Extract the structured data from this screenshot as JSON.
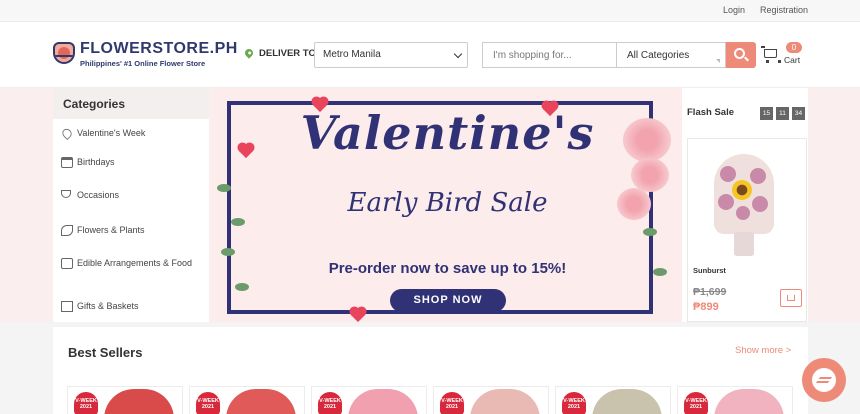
{
  "topbar": {
    "login": "Login",
    "register": "Registration"
  },
  "header": {
    "brand": "FLOWERSTORE.PH",
    "tagline": "Philippines' #1 Online Flower Store",
    "deliver_label": "DELIVER TO",
    "location": "Metro Manila",
    "search_placeholder": "I'm shopping for...",
    "category_select": "All Categories",
    "cart_count": "0",
    "cart_label": "Cart"
  },
  "sidebar": {
    "title": "Categories",
    "items": [
      {
        "label": "Valentine's Week",
        "icon": "heart-icon"
      },
      {
        "label": "Birthdays",
        "icon": "cake-icon"
      },
      {
        "label": "Occasions",
        "icon": "wine-glass-icon"
      },
      {
        "label": "Flowers & Plants",
        "icon": "plant-icon"
      },
      {
        "label": "Edible Arrangements & Food",
        "icon": "basket-icon"
      },
      {
        "label": "Gifts & Baskets",
        "icon": "gift-icon"
      }
    ]
  },
  "banner": {
    "line1": "Valentine's",
    "line2": "Early Bird Sale",
    "promo": "Pre-order now to save up to 15%!",
    "cta": "SHOP NOW"
  },
  "flash_sale": {
    "title": "Flash Sale",
    "timer": [
      "15",
      "11",
      "34"
    ],
    "product": {
      "name": "Sunburst",
      "old_price": "₱1,699",
      "new_price": "₱899"
    }
  },
  "best_sellers": {
    "title": "Best Sellers",
    "more": "Show more >",
    "badge_line1": "V-WEEK",
    "badge_line2": "2021"
  },
  "colors": {
    "accent": "#ee8a78",
    "brand_navy": "#303275",
    "badge_red": "#d8283b"
  }
}
